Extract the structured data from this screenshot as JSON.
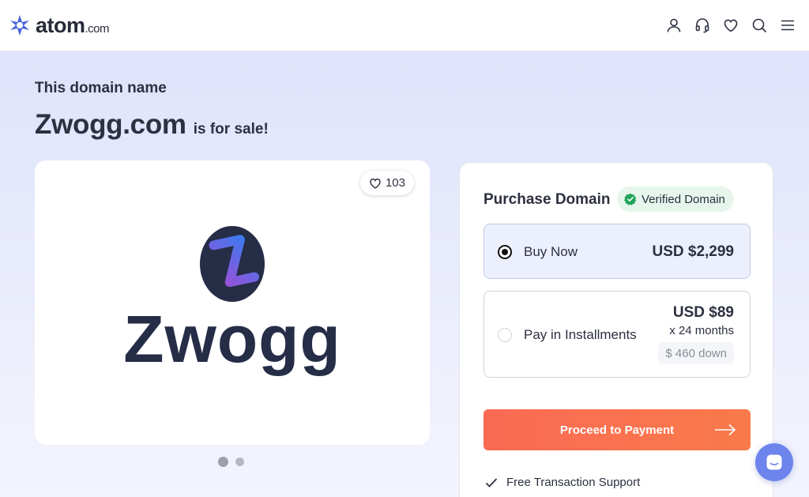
{
  "header": {
    "logo_name": "atom",
    "logo_tld": ".com",
    "icons": [
      "user-icon",
      "headset-icon",
      "heart-icon",
      "search-icon",
      "menu-icon"
    ]
  },
  "hero": {
    "eyebrow": "This domain name",
    "domain": "Zwogg.com",
    "suffix": "is for sale!"
  },
  "image_card": {
    "likes": "103",
    "brand_word": "Zwogg",
    "carousel_total": 2,
    "carousel_active": 1
  },
  "purchase": {
    "title": "Purchase Domain",
    "verified_label": "Verified Domain",
    "options": [
      {
        "label": "Buy Now",
        "price": "USD $2,299",
        "selected": true
      },
      {
        "label": "Pay in Installments",
        "price": "USD $89",
        "term": "x 24 months",
        "down": "$ 460 down",
        "selected": false
      }
    ],
    "cta_label": "Proceed to Payment",
    "features": [
      "Free Transaction Support"
    ]
  },
  "colors": {
    "accent": "#fb6a54",
    "brand_navy": "#252d47",
    "verified_green": "#22a55b",
    "chat_blue": "#6c84ec"
  }
}
